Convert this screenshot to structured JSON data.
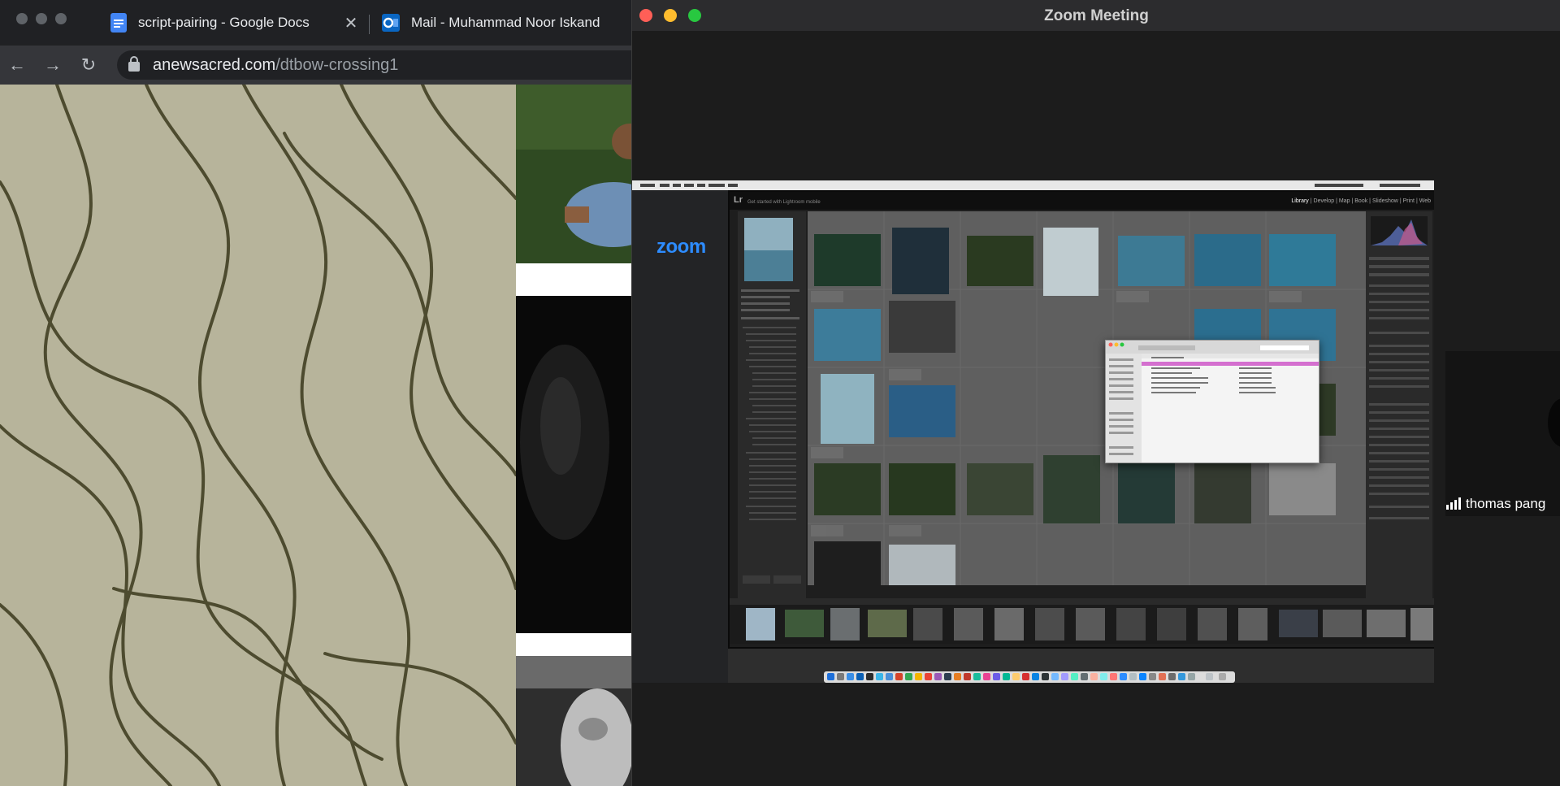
{
  "chrome": {
    "tabs": [
      {
        "title": "script-pairing - Google Docs",
        "icon": "google-docs-icon",
        "close": "✕"
      },
      {
        "title": "Mail - Muhammad Noor Iskand",
        "icon": "outlook-icon",
        "close": "✕"
      }
    ],
    "address": {
      "domain": "anewsacred.com",
      "path": "/dtbow-crossing1"
    },
    "nav": {
      "back": "←",
      "forward": "→",
      "reload": "↻"
    }
  },
  "zoom": {
    "window_title": "Zoom Meeting",
    "logo": "zoom",
    "participant": {
      "name": "thomas pang"
    }
  },
  "shared_screen": {
    "lightroom": {
      "logo": "Lr",
      "subtitle": "Get started with Lightroom mobile",
      "modules": [
        "Library",
        "Develop",
        "Map",
        "Book",
        "Slideshow",
        "Print",
        "Web"
      ],
      "active_module": "Library"
    }
  },
  "colors": {
    "zoom_blue": "#2d8cff",
    "close_red": "#ff5f57",
    "minimize_yellow": "#febc2e",
    "zoom_green": "#28c840"
  }
}
